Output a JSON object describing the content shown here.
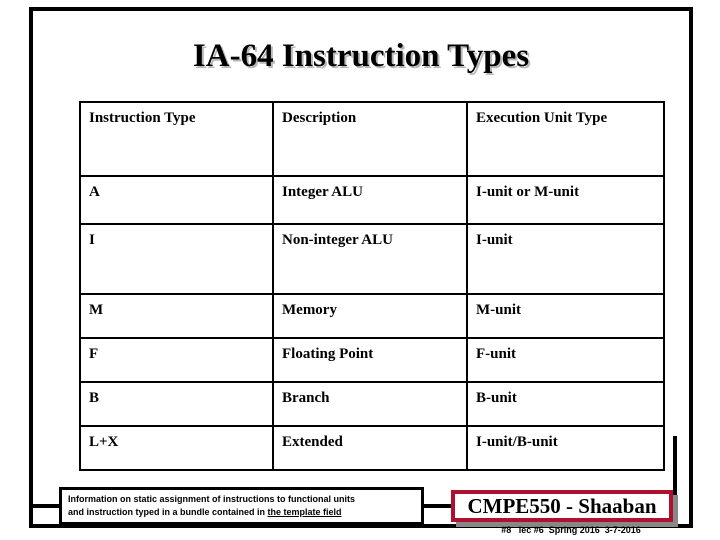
{
  "slide": {
    "title": "IA-64 Instruction Types"
  },
  "table": {
    "headers": [
      "Instruction Type",
      "Description",
      "Execution Unit Type"
    ],
    "rows": [
      {
        "type": "A",
        "description": "Integer ALU",
        "unit": "I-unit or M-unit"
      },
      {
        "type": "I",
        "description": "Non-integer ALU",
        "unit": "I-unit"
      },
      {
        "type": "M",
        "description": "Memory",
        "unit": "M-unit"
      },
      {
        "type": "F",
        "description": "Floating Point",
        "unit": "F-unit"
      },
      {
        "type": "B",
        "description": "Branch",
        "unit": "B-unit"
      },
      {
        "type": "L+X",
        "description": "Extended",
        "unit": "I-unit/B-unit"
      }
    ]
  },
  "note": {
    "line1": "Information on static assignment of instructions  to functional units",
    "line2_prefix": "and instruction typed in a bundle contained in ",
    "line2_underlined": "the template field"
  },
  "footer": {
    "banner_text": "CMPE550 - Shaaban",
    "meta_text": "#8   lec #6  Spring 2016  3-7-2016",
    "banner_border_color": "#b01030",
    "banner_shadow_color": "#888888"
  }
}
